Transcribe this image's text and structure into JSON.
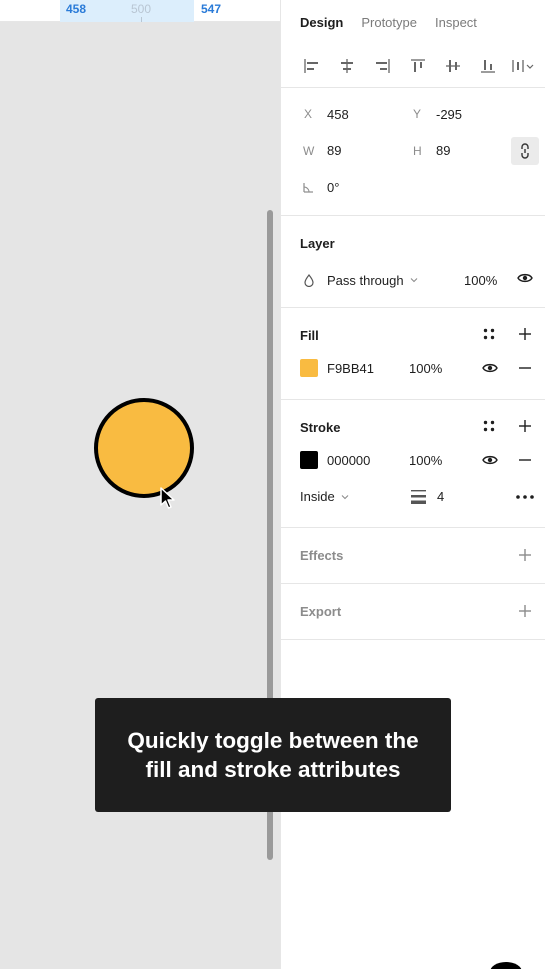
{
  "ruler": {
    "left": "458",
    "center": "500",
    "right": "547"
  },
  "tabs": [
    {
      "label": "Design",
      "active": true
    },
    {
      "label": "Prototype",
      "active": false
    },
    {
      "label": "Inspect",
      "active": false
    }
  ],
  "align_icons": [
    "align-left-icon",
    "align-horizontal-center-icon",
    "align-right-icon",
    "align-top-icon",
    "align-vertical-center-icon",
    "align-bottom-icon",
    "distribute-icon"
  ],
  "geometry": {
    "x_label": "X",
    "x_value": "458",
    "y_label": "Y",
    "y_value": "-295",
    "w_label": "W",
    "w_value": "89",
    "h_label": "H",
    "h_value": "89",
    "rotation_value": "0°"
  },
  "layer": {
    "title": "Layer",
    "blend_mode": "Pass through",
    "opacity": "100%"
  },
  "fill": {
    "title": "Fill",
    "color_hex": "F9BB41",
    "color": "#F9BB41",
    "opacity": "100%"
  },
  "stroke": {
    "title": "Stroke",
    "color_hex": "000000",
    "color": "#000000",
    "opacity": "100%",
    "position": "Inside",
    "weight": "4"
  },
  "effects": {
    "title": "Effects"
  },
  "export": {
    "title": "Export"
  },
  "caption": {
    "text": "Quickly toggle between the fill and stroke attributes"
  },
  "colors": {
    "accent": "#2a7bd8",
    "circle_fill": "#F9BB41"
  }
}
